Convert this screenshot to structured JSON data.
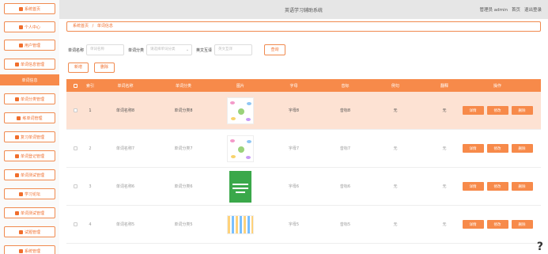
{
  "app": {
    "title": "英语学习辅助系统",
    "user_label": "管理员 admin",
    "home_link": "首页",
    "logout_link": "退出登录"
  },
  "sidebar": {
    "items": [
      {
        "label": "系统首页",
        "icon": "home-icon"
      },
      {
        "label": "个人中心",
        "icon": "user-icon"
      },
      {
        "label": "用户管理",
        "icon": "users-icon"
      },
      {
        "label": "单词信息管理",
        "icon": "grid-icon"
      },
      {
        "label": "单词信息",
        "icon": "",
        "active": true
      },
      {
        "label": "单词分类管理",
        "icon": "grid-icon"
      },
      {
        "label": "练单词管理",
        "icon": "user-icon"
      },
      {
        "label": "复习单词管理",
        "icon": "book-icon"
      },
      {
        "label": "单词登记管理",
        "icon": "grid-icon"
      },
      {
        "label": "单词测试管理",
        "icon": "grid-icon"
      },
      {
        "label": "学习论坛",
        "icon": "forum-icon"
      },
      {
        "label": "单词测试管理",
        "icon": "grid-icon"
      },
      {
        "label": "试题管理",
        "icon": "doc-icon"
      },
      {
        "label": "系统管理",
        "icon": "grid-icon"
      }
    ]
  },
  "breadcrumb": {
    "home": "系统首页",
    "sep": "/",
    "current": "单词信息"
  },
  "search": {
    "name_label": "单词名称",
    "name_placeholder": "单词名称",
    "category_label": "单词分类",
    "category_placeholder": "请选择单词分类",
    "cn_label": "英文互译",
    "cn_placeholder": "英文互译",
    "search_button": "查询"
  },
  "actions": {
    "add": "新增",
    "delete": "删除"
  },
  "table": {
    "headers": [
      "",
      "索引",
      "单词名称",
      "单词分类",
      "图片",
      "字母",
      "音标",
      "例句",
      "翻释",
      "操作"
    ],
    "ops": {
      "detail": "详情",
      "edit": "修改",
      "delete": "删除"
    },
    "rows": [
      {
        "index": "1",
        "name": "单词名称8",
        "category": "单词分类8",
        "letter": "字母8",
        "phonetic": "音标8",
        "example": "无",
        "translation": "无",
        "image": "mindmap"
      },
      {
        "index": "2",
        "name": "单词名称7",
        "category": "单词分类7",
        "letter": "字母7",
        "phonetic": "音标7",
        "example": "无",
        "translation": "无",
        "image": "mindmap"
      },
      {
        "index": "3",
        "name": "单词名称6",
        "category": "单词分类6",
        "letter": "字母6",
        "phonetic": "音标6",
        "example": "无",
        "translation": "无",
        "image": "book"
      },
      {
        "index": "4",
        "name": "单词名称5",
        "category": "单词分类5",
        "letter": "字母5",
        "phonetic": "音标5",
        "example": "无",
        "translation": "无",
        "image": "alphabet"
      }
    ]
  },
  "colors": {
    "accent": "#f78a4a",
    "accent_text": "#f06e2c",
    "row_highlight": "#fde2d3",
    "topbar": "#e6e6e6"
  },
  "help_glyph": "?"
}
